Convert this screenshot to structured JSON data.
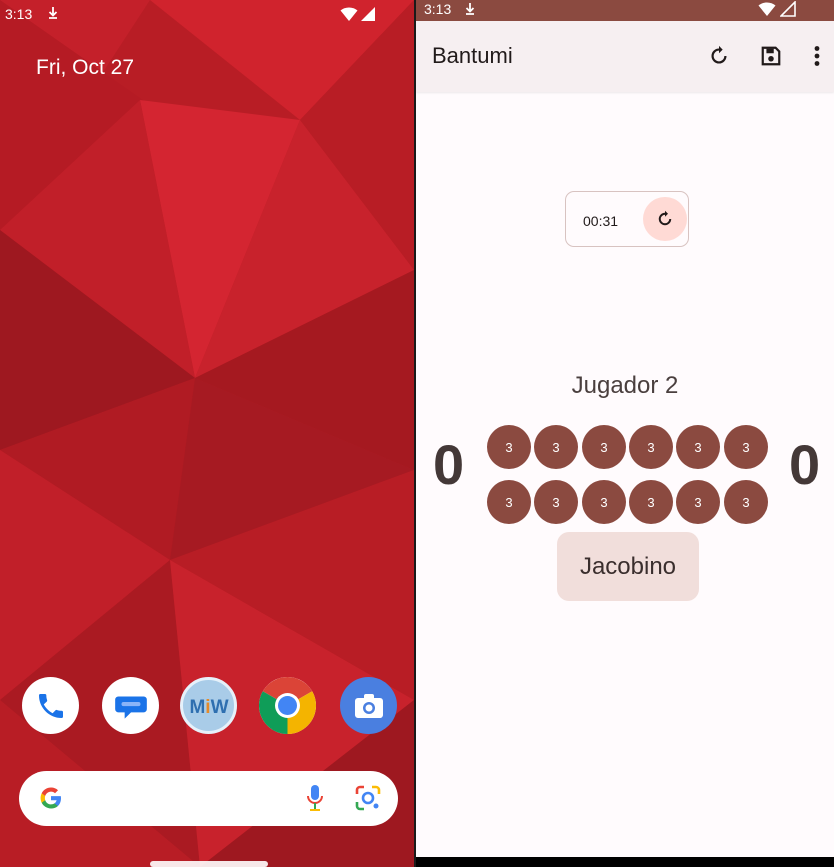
{
  "home": {
    "status_time": "3:13",
    "date": "Fri, Oct 27",
    "dock_apps": [
      {
        "name": "Phone",
        "icon": "phone-icon"
      },
      {
        "name": "Messages",
        "icon": "messages-icon"
      },
      {
        "name": "MiW",
        "icon": "miw-icon",
        "logo_text": "MiW"
      },
      {
        "name": "Chrome",
        "icon": "chrome-icon"
      },
      {
        "name": "Camera",
        "icon": "camera-icon"
      }
    ],
    "search_icons": [
      "google-g-icon",
      "mic-icon",
      "lens-icon"
    ]
  },
  "app": {
    "status_time": "3:13",
    "title": "Bantumi",
    "toolbar_icons": [
      "restart-icon",
      "save-icon",
      "more-vert-icon"
    ],
    "timer": "00:31",
    "player_label": "Jugador 2",
    "store_left": "0",
    "store_right": "0",
    "top_row": [
      "3",
      "3",
      "3",
      "3",
      "3",
      "3"
    ],
    "bottom_row": [
      "3",
      "3",
      "3",
      "3",
      "3",
      "3"
    ],
    "turn_button": "Jacobino",
    "colors": {
      "accent": "#8b4a40",
      "appbar": "#f6eff1",
      "reset_bg": "#ffdad5",
      "turn_bg": "#f1dedb"
    }
  }
}
